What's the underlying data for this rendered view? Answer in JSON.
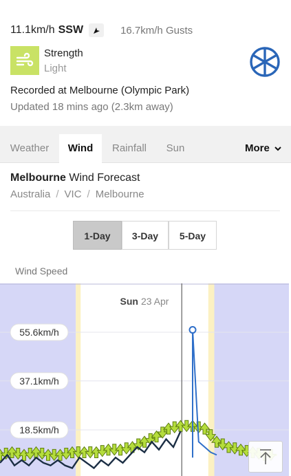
{
  "current": {
    "speed": "11.1km/h",
    "direction": "SSW",
    "gusts": "16.7km/h Gusts",
    "strength_label": "Strength",
    "strength_value": "Light",
    "recorded": "Recorded at Melbourne (Olympic Park)",
    "updated": "Updated 18 mins ago (2.3km away)"
  },
  "tabs": [
    {
      "label": "Weather",
      "active": false
    },
    {
      "label": "Wind",
      "active": true
    },
    {
      "label": "Rainfall",
      "active": false
    },
    {
      "label": "Sun",
      "active": false
    }
  ],
  "more_label": "More",
  "forecast": {
    "title_bold": "Melbourne",
    "title_rest": " Wind Forecast",
    "breadcrumb": [
      "Australia",
      "VIC",
      "Melbourne"
    ]
  },
  "range_buttons": [
    {
      "label": "1-Day",
      "selected": true
    },
    {
      "label": "3-Day",
      "selected": false
    },
    {
      "label": "5-Day",
      "selected": false
    }
  ],
  "chart_label": "Wind Speed",
  "chart_data": {
    "type": "line",
    "title": "Wind Speed",
    "day_label_bold": "Sun",
    "day_label": "23 Apr",
    "y_tick_labels": [
      "55.6km/h",
      "37.1km/h",
      "18.5km/h"
    ],
    "y_ticks": [
      55.6,
      37.1,
      18.5
    ],
    "ylim": [
      0,
      72
    ],
    "xlim": [
      0,
      24
    ],
    "night_spans": [
      [
        0,
        6.3
      ],
      [
        17.8,
        24
      ]
    ],
    "twilight_spans": [
      [
        6.3,
        6.7
      ],
      [
        17.3,
        17.8
      ]
    ],
    "now_hour": 15.1,
    "series": [
      {
        "name": "Observed",
        "color": "#1b2e44",
        "x": [
          0,
          0.6,
          1.2,
          1.8,
          2.4,
          3.0,
          3.6,
          4.2,
          4.8,
          5.4,
          6.0,
          6.6,
          7.2,
          7.8,
          8.4,
          9.0,
          9.6,
          10.2,
          10.8,
          11.4,
          12.0,
          12.6,
          13.2,
          13.8,
          14.4,
          15.0
        ],
        "values": [
          6,
          9,
          5,
          7,
          5,
          8,
          6,
          5,
          7,
          5,
          4,
          8,
          6,
          4,
          7,
          5,
          8,
          6,
          9,
          12,
          10,
          14,
          11,
          15,
          12,
          18
        ]
      },
      {
        "name": "Gust",
        "color": "#2f6fc9",
        "x": [
          16.0,
          16.0,
          16.5,
          17.0,
          17.5,
          18.0
        ],
        "values": [
          8,
          56.5,
          14,
          12,
          10,
          9
        ]
      },
      {
        "name": "Forecast",
        "color": "#9ecb2c",
        "x": [
          0,
          1,
          2,
          3,
          4,
          5,
          6,
          7,
          8,
          9,
          10,
          11,
          12,
          13,
          14,
          15,
          16,
          17,
          18,
          19,
          20,
          21,
          22,
          23
        ],
        "values": [
          9,
          10,
          9,
          10,
          9,
          9,
          10,
          10,
          10,
          11,
          11,
          12,
          14,
          16,
          19,
          20,
          20,
          19,
          14,
          12,
          11,
          10,
          9,
          9
        ]
      }
    ]
  }
}
